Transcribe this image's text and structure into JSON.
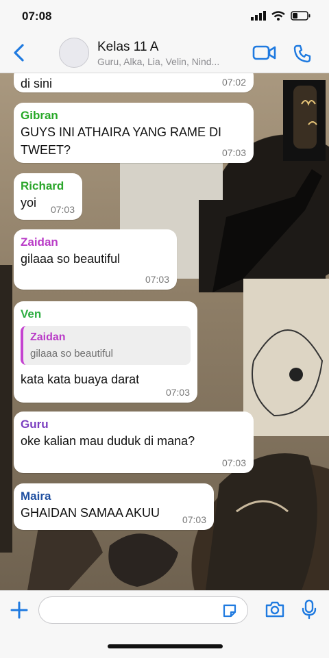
{
  "status": {
    "time": "07:08"
  },
  "header": {
    "title": "Kelas 11 A",
    "subtitle": "Guru, Alka, Lia, Velin, Nind..."
  },
  "messages": [
    {
      "sender": "",
      "text": "di sini",
      "time": "07:02"
    },
    {
      "sender": "Gibran",
      "color": "#27a827",
      "text": "GUYS INI ATHAIRA YANG RAME DI TWEET?",
      "time": "07:03"
    },
    {
      "sender": "Richard",
      "color": "#2aa52a",
      "text": "yoi",
      "time": "07:03"
    },
    {
      "sender": "Zaidan",
      "color": "#b93bc7",
      "text": "gilaaa so beautiful",
      "time": "07:03"
    },
    {
      "sender": "Ven",
      "color": "#2fae43",
      "text": "kata kata buaya darat",
      "time": "07:03",
      "quote": {
        "name": "Zaidan",
        "text": "gilaaa so beautiful"
      }
    },
    {
      "sender": "Guru",
      "color": "#7b3fc0",
      "text": "oke kalian mau duduk di mana?",
      "time": "07:03"
    },
    {
      "sender": "Maira",
      "color": "#1f4fa0",
      "text": "GHAIDAN SAMAA AKUU",
      "time": "07:03"
    }
  ],
  "colors": {
    "accent": "#1f7ae0"
  },
  "icons": [
    "back-chevron-icon",
    "video-call-icon",
    "phone-icon",
    "plus-icon",
    "sticker-icon",
    "camera-icon",
    "microphone-icon"
  ]
}
